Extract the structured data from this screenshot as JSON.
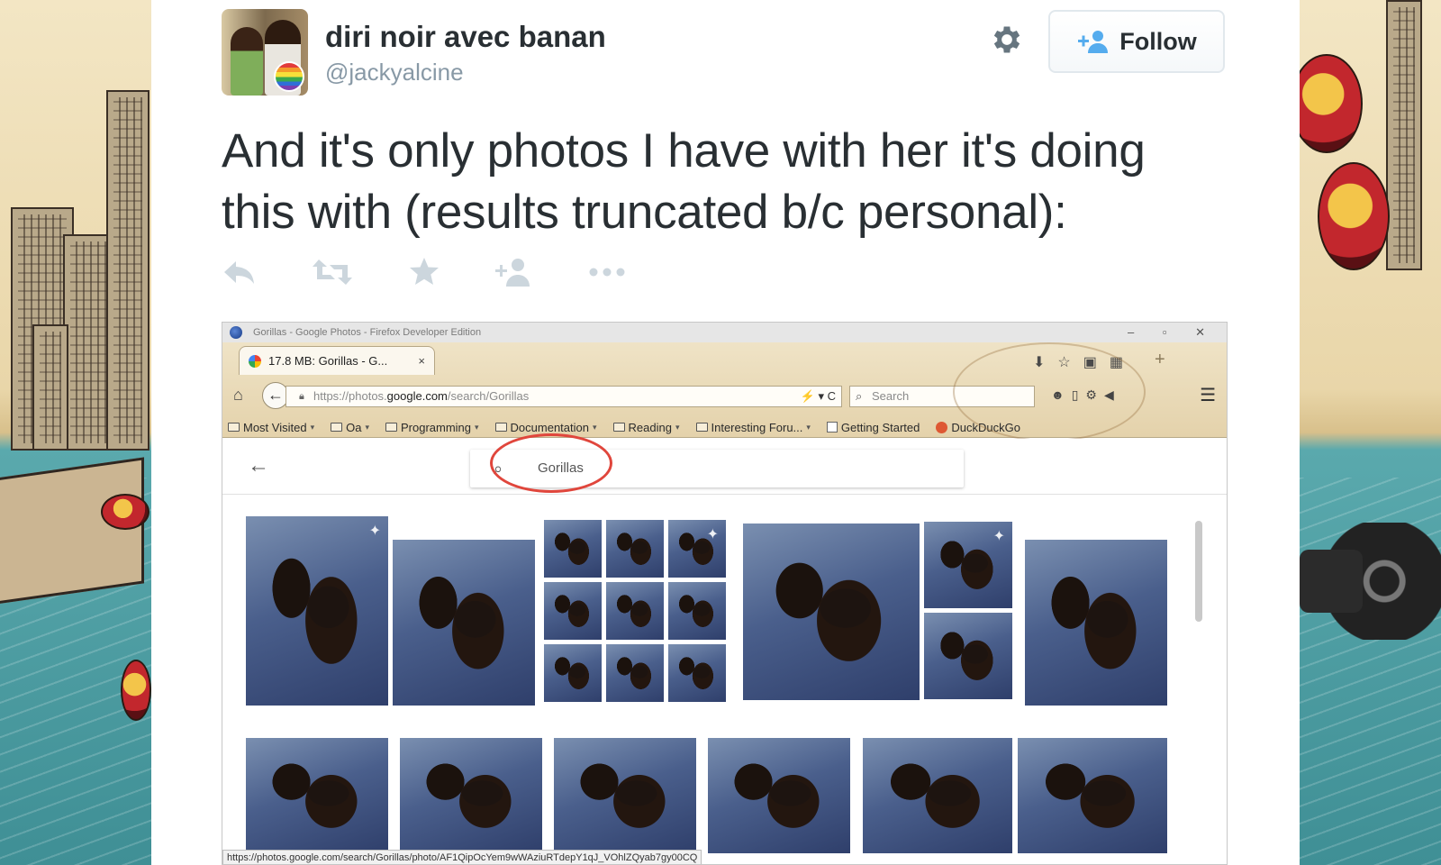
{
  "tweet": {
    "display_name": "diri noir avec banan",
    "handle": "@jackyalcine",
    "follow_label": "Follow",
    "text": "And it's only photos I have with her it's doing this with (results truncated b/c personal):",
    "actions": [
      "reply-icon",
      "retweet-icon",
      "favorite-icon",
      "follow-user-icon",
      "more-icon"
    ],
    "colors": {
      "name": "#292f33",
      "handle": "#8899a6",
      "actions": "#ccd6dd",
      "follow_icon": "#55acee"
    }
  },
  "screenshot": {
    "window_title": "Gorillas - Google Photos - Firefox Developer Edition",
    "window_buttons": "– ▫ ✕",
    "tab_label": "17.8 MB: Gorillas - G...",
    "tab_close": "×",
    "new_tab": "+",
    "url_prefix": "https://photos.",
    "url_domain": "google.com",
    "url_path": "/search/Gorillas",
    "url_tail": "⚡ ▾ C",
    "search_placeholder": "Search",
    "bookmarks": [
      {
        "label": "Most Visited",
        "icon": "folder-icon"
      },
      {
        "label": "Oa",
        "icon": "folder-icon"
      },
      {
        "label": "Programming",
        "icon": "folder-icon"
      },
      {
        "label": "Documentation",
        "icon": "folder-icon"
      },
      {
        "label": "Reading",
        "icon": "folder-icon"
      },
      {
        "label": "Interesting Foru...",
        "icon": "folder-icon"
      },
      {
        "label": "Getting Started",
        "icon": "checkbox-icon"
      },
      {
        "label": "DuckDuckGo",
        "icon": "duckduckgo-icon"
      }
    ],
    "photos_search_value": "Gorillas",
    "status_url": "https://photos.google.com/search/Gorillas/photo/AF1QipOcYem9wWAziuRTdepY1qJ_VOhlZQyab7gy00CQ",
    "highlight_color": "#e0463c"
  }
}
